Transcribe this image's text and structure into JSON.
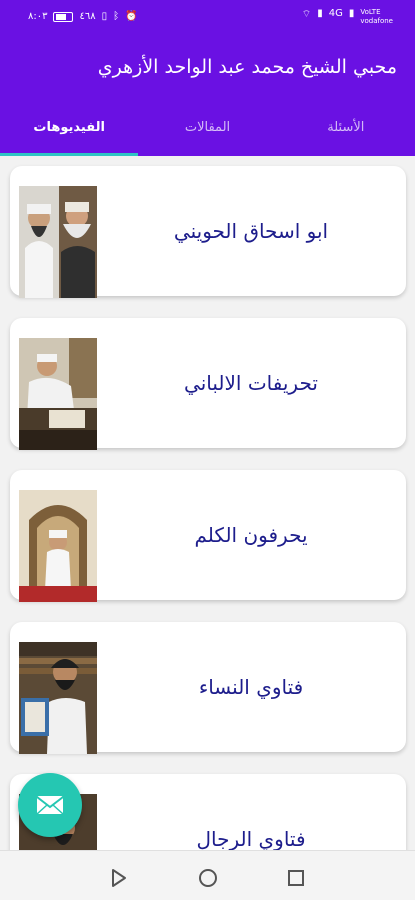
{
  "status_bar": {
    "time": "٨:٠٣",
    "battery_percent": "٤٦٨",
    "carrier_top": "VoLTE",
    "carrier_name": "vodafone",
    "signal_text": "4G"
  },
  "app_bar": {
    "title": "محبي الشيخ محمد عبد الواحد الأزهري"
  },
  "tabs": [
    {
      "label": "الأسئلة",
      "active": false
    },
    {
      "label": "المقالات",
      "active": false
    },
    {
      "label": "الفيديوهات",
      "active": true
    }
  ],
  "videos": [
    {
      "title": "ابو اسحاق الحويني"
    },
    {
      "title": "تحريفات الالباني"
    },
    {
      "title": "يحرفون الكلم"
    },
    {
      "title": "فتاوي النساء"
    },
    {
      "title": "فتاوي الرجال"
    }
  ],
  "fab": {
    "icon": "email-icon"
  },
  "nav": {
    "back": "back-icon",
    "home": "home-icon",
    "recents": "recents-icon"
  },
  "colors": {
    "primary": "#6a11e3",
    "accent": "#2ec4c4",
    "fab": "#25c7b2",
    "card_title": "#1d1d8c"
  }
}
